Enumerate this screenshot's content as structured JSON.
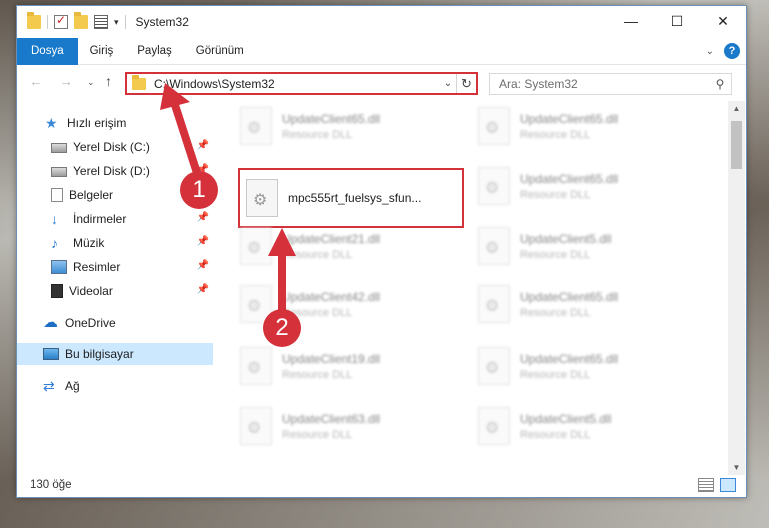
{
  "window": {
    "title": "System32",
    "controls": {
      "minimize": "—",
      "maximize": "☐",
      "close": "✕"
    }
  },
  "ribbon": {
    "tabs": [
      "Dosya",
      "Giriş",
      "Paylaş",
      "Görünüm"
    ],
    "help_label": "?"
  },
  "navbar": {
    "address": "C:\\Windows\\System32",
    "search_placeholder": "Ara: System32"
  },
  "navpane": {
    "items": [
      {
        "label": "Hızlı erişim",
        "icon": "star-icon"
      },
      {
        "label": "Yerel Disk (C:)",
        "icon": "drive-icon",
        "pinned": true
      },
      {
        "label": "Yerel Disk (D:)",
        "icon": "drive-icon",
        "pinned": true
      },
      {
        "label": "Belgeler",
        "icon": "documents-icon",
        "pinned": true
      },
      {
        "label": "İndirmeler",
        "icon": "downloads-icon",
        "pinned": true
      },
      {
        "label": "Müzik",
        "icon": "music-icon",
        "pinned": true
      },
      {
        "label": "Resimler",
        "icon": "pictures-icon",
        "pinned": true
      },
      {
        "label": "Videolar",
        "icon": "videos-icon",
        "pinned": true
      },
      {
        "label": "OneDrive",
        "icon": "onedrive-icon"
      },
      {
        "label": "Bu bilgisayar",
        "icon": "this-pc-icon",
        "selected": true
      },
      {
        "label": "Ağ",
        "icon": "network-icon"
      }
    ]
  },
  "files": {
    "highlighted": {
      "name": "mpc555rt_fuelsys_sfun..."
    },
    "items": [
      {
        "name": "UpdateClient65.dll",
        "type": "Resource DLL"
      },
      {
        "name": "UpdateClient65.dll",
        "type": "Resource DLL"
      },
      {
        "name": "UpdateClient65.dll",
        "type": "Resource DLL"
      },
      {
        "name": "UpdateClient21.dll",
        "type": "Resource DLL"
      },
      {
        "name": "UpdateClient5.dll",
        "type": "Resource DLL"
      },
      {
        "name": "UpdateClient42.dll",
        "type": "Resource DLL"
      },
      {
        "name": "UpdateClient65.dll",
        "type": "Resource DLL"
      },
      {
        "name": "UpdateClient19.dll",
        "type": "Resource DLL"
      },
      {
        "name": "UpdateClient65.dll",
        "type": "Resource DLL"
      },
      {
        "name": "UpdateClient63.dll",
        "type": "Resource DLL"
      },
      {
        "name": "UpdateClient5.dll",
        "type": "Resource DLL"
      }
    ]
  },
  "statusbar": {
    "count": "130 öğe"
  },
  "callouts": {
    "step1": "1",
    "step2": "2"
  },
  "colors": {
    "accent": "#1979ca",
    "highlight": "#d5313a",
    "selection": "#cce8ff"
  }
}
